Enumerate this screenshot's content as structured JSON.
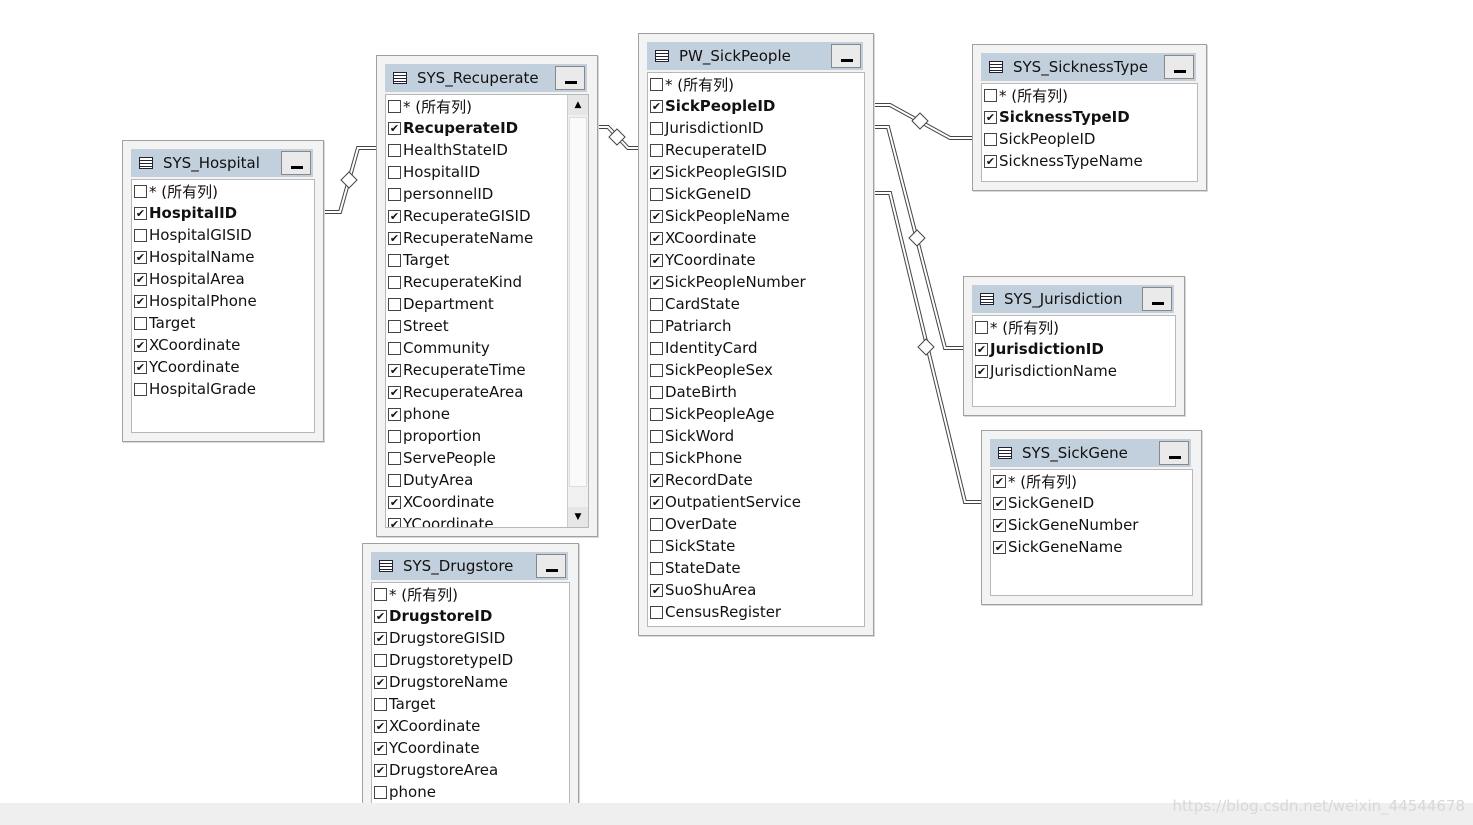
{
  "tables": [
    {
      "id": "t-hospital",
      "name": "SYS_Hospital",
      "columns": [
        {
          "n": "* (所有列)",
          "c": false
        },
        {
          "n": "HospitalID",
          "c": true,
          "b": true
        },
        {
          "n": "HospitalGISID",
          "c": false
        },
        {
          "n": "HospitalName",
          "c": true
        },
        {
          "n": "HospitalArea",
          "c": true
        },
        {
          "n": "HospitalPhone",
          "c": true
        },
        {
          "n": "Target",
          "c": false
        },
        {
          "n": "XCoordinate",
          "c": true
        },
        {
          "n": "YCoordinate",
          "c": true
        },
        {
          "n": "HospitalGrade",
          "c": false
        }
      ]
    },
    {
      "id": "t-recuperate",
      "name": "SYS_Recuperate",
      "scroll": true,
      "columns": [
        {
          "n": "* (所有列)",
          "c": false
        },
        {
          "n": "RecuperateID",
          "c": true,
          "b": true
        },
        {
          "n": "HealthStateID",
          "c": false
        },
        {
          "n": "HospitalID",
          "c": false
        },
        {
          "n": "personnelID",
          "c": false
        },
        {
          "n": "RecuperateGISID",
          "c": true
        },
        {
          "n": "RecuperateName",
          "c": true
        },
        {
          "n": "Target",
          "c": false
        },
        {
          "n": "RecuperateKind",
          "c": false
        },
        {
          "n": "Department",
          "c": false
        },
        {
          "n": "Street",
          "c": false
        },
        {
          "n": "Community",
          "c": false
        },
        {
          "n": "RecuperateTime",
          "c": true
        },
        {
          "n": "RecuperateArea",
          "c": true
        },
        {
          "n": "phone",
          "c": true
        },
        {
          "n": "proportion",
          "c": false
        },
        {
          "n": "ServePeople",
          "c": false
        },
        {
          "n": "DutyArea",
          "c": false
        },
        {
          "n": "XCoordinate",
          "c": true
        },
        {
          "n": "YCoordinate",
          "c": true
        }
      ]
    },
    {
      "id": "t-sickpeople",
      "name": "PW_SickPeople",
      "columns": [
        {
          "n": "* (所有列)",
          "c": false
        },
        {
          "n": "SickPeopleID",
          "c": true,
          "b": true
        },
        {
          "n": "JurisdictionID",
          "c": false
        },
        {
          "n": "RecuperateID",
          "c": false
        },
        {
          "n": "SickPeopleGISID",
          "c": true
        },
        {
          "n": "SickGeneID",
          "c": false
        },
        {
          "n": "SickPeopleName",
          "c": true
        },
        {
          "n": "XCoordinate",
          "c": true
        },
        {
          "n": "YCoordinate",
          "c": true
        },
        {
          "n": "SickPeopleNumber",
          "c": true
        },
        {
          "n": "CardState",
          "c": false
        },
        {
          "n": "Patriarch",
          "c": false
        },
        {
          "n": "IdentityCard",
          "c": false
        },
        {
          "n": "SickPeopleSex",
          "c": false
        },
        {
          "n": "DateBirth",
          "c": false
        },
        {
          "n": "SickPeopleAge",
          "c": false
        },
        {
          "n": "SickWord",
          "c": false
        },
        {
          "n": "SickPhone",
          "c": false
        },
        {
          "n": "RecordDate",
          "c": true
        },
        {
          "n": "OutpatientService",
          "c": true
        },
        {
          "n": "OverDate",
          "c": false
        },
        {
          "n": "SickState",
          "c": false
        },
        {
          "n": "StateDate",
          "c": false
        },
        {
          "n": "SuoShuArea",
          "c": true
        },
        {
          "n": "CensusRegister",
          "c": false
        }
      ]
    },
    {
      "id": "t-sicknesstype",
      "name": "SYS_SicknessType",
      "columns": [
        {
          "n": "* (所有列)",
          "c": false
        },
        {
          "n": "SicknessTypeID",
          "c": true,
          "b": true
        },
        {
          "n": "SickPeopleID",
          "c": false
        },
        {
          "n": "SicknessTypeName",
          "c": true
        }
      ]
    },
    {
      "id": "t-jurisdiction",
      "name": "SYS_Jurisdiction",
      "columns": [
        {
          "n": "* (所有列)",
          "c": false
        },
        {
          "n": "JurisdictionID",
          "c": true,
          "b": true
        },
        {
          "n": "JurisdictionName",
          "c": true
        }
      ]
    },
    {
      "id": "t-sickgene",
      "name": "SYS_SickGene",
      "columns": [
        {
          "n": "* (所有列)",
          "c": true
        },
        {
          "n": "SickGeneID",
          "c": true
        },
        {
          "n": "SickGeneNumber",
          "c": true
        },
        {
          "n": "SickGeneName",
          "c": true
        }
      ]
    },
    {
      "id": "t-drugstore",
      "name": "SYS_Drugstore",
      "columns": [
        {
          "n": "* (所有列)",
          "c": false
        },
        {
          "n": "DrugstoreID",
          "c": true,
          "b": true
        },
        {
          "n": "DrugstoreGISID",
          "c": true
        },
        {
          "n": "DrugstoretypeID",
          "c": false
        },
        {
          "n": "DrugstoreName",
          "c": true
        },
        {
          "n": "Target",
          "c": false
        },
        {
          "n": "XCoordinate",
          "c": true
        },
        {
          "n": "YCoordinate",
          "c": true
        },
        {
          "n": "DrugstoreArea",
          "c": true
        },
        {
          "n": "phone",
          "c": false
        }
      ]
    }
  ],
  "watermark": "https://blog.csdn.net/weixin_44544678"
}
